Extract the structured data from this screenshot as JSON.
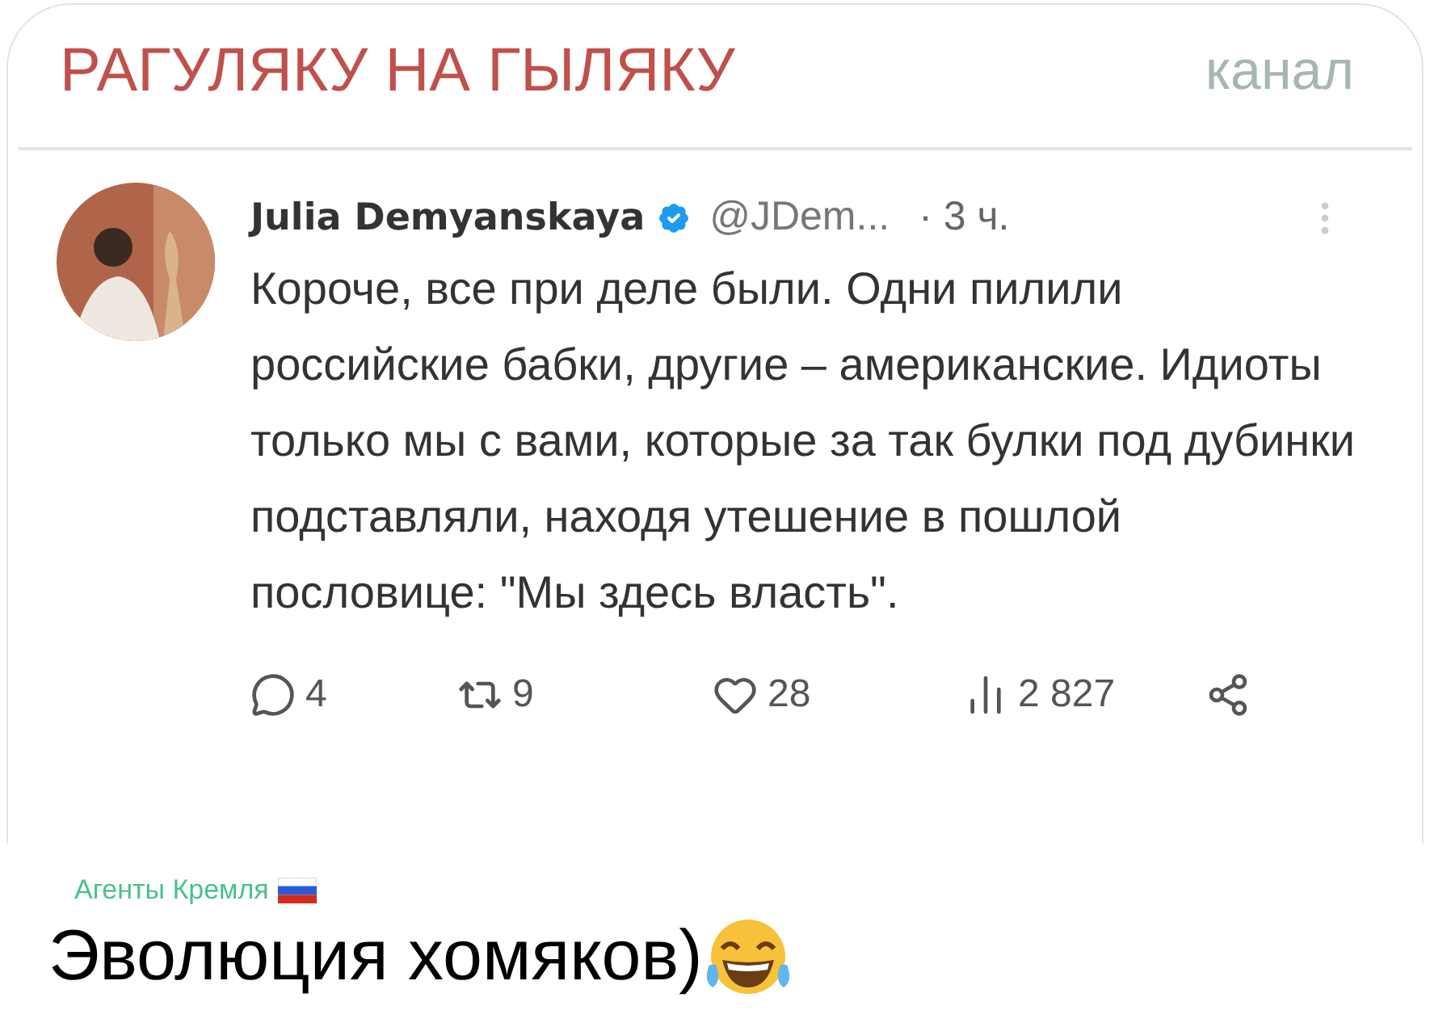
{
  "channel": {
    "title": "РАГУЛЯКУ НА ГЫЛЯКУ",
    "badge": "канал"
  },
  "tweet": {
    "name": "Julia Demyanskaya",
    "verified": true,
    "handle": "@JDem...",
    "time": "· 3 ч.",
    "text": "Короче, все при деле были. Одни пилили российские бабки, другие – американские. Идиоты только мы с вами, которые за так булки под дубинки подставляли, находя утешение в пошлой пословице: \"Мы здесь власть\".",
    "actions": [
      {
        "kind": "reply",
        "count": "4"
      },
      {
        "kind": "repost",
        "count": "9"
      },
      {
        "kind": "like",
        "count": "28"
      },
      {
        "kind": "views",
        "count": "2 827"
      },
      {
        "kind": "share"
      }
    ]
  },
  "caption": {
    "source": "Агенты Кремля",
    "text": "Эволюция хомяков)"
  }
}
